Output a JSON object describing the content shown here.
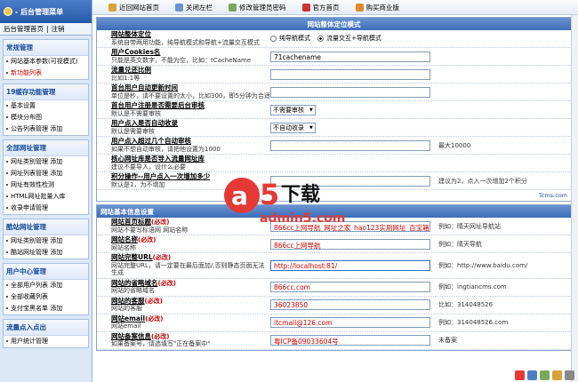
{
  "sidebar": {
    "title": "- 后台管理菜单",
    "user_links": [
      "后台管理首页",
      "注销"
    ],
    "groups": [
      {
        "title": "常规管理",
        "items": [
          {
            "label": "网站基本参数(可视模式)"
          },
          {
            "label": "新功能列表",
            "red": true
          }
        ]
      },
      {
        "title": "19缓存功能管理",
        "items": [
          {
            "label": "基本设置"
          },
          {
            "label": "模块分布图"
          },
          {
            "label": "公告列表管理  添加"
          }
        ]
      },
      {
        "title": "全部网址管理",
        "items": [
          {
            "label": "网址类别管理  添加"
          },
          {
            "label": "网址列表管理  添加"
          },
          {
            "label": "网址有效性检测"
          },
          {
            "label": "HTML网址批量入库"
          },
          {
            "label": "收录申请管理"
          }
        ]
      },
      {
        "title": "酷站网址管理",
        "items": [
          {
            "label": "网址类别管理  添加"
          },
          {
            "label": "酷站网址管理  添加"
          }
        ]
      },
      {
        "title": "用户中心管理",
        "items": [
          {
            "label": "全部用户列表  添加"
          },
          {
            "label": "全部收藏列表"
          },
          {
            "label": "支付宝黑名单  添加"
          }
        ]
      },
      {
        "title": "流量点入点出",
        "items": [
          {
            "label": "用户统计管理"
          }
        ]
      }
    ]
  },
  "topbar": {
    "links": [
      {
        "label": "近回网站首页",
        "icon": "home-icon",
        "color": "#d9a13a"
      },
      {
        "label": "关闭左栏",
        "icon": "close-sidebar-icon",
        "color": "#6b93d0"
      },
      {
        "label": "修改管理员密码",
        "icon": "key-icon",
        "color": "#7aa85a"
      },
      {
        "label": "官方首页",
        "icon": "flag-icon",
        "color": "#cc3333"
      },
      {
        "label": "购买商业版",
        "icon": "cart-icon",
        "color": "#e08a2a"
      }
    ]
  },
  "panel1": {
    "title": "网站整体定位模式",
    "rows": [
      {
        "label": "网站整体定位",
        "desc": "系统自带两用功能，纯导航模式和导航+流量交互模式",
        "type": "radio",
        "options": [
          "纯导航模式",
          "流量交互+导航模式"
        ],
        "selected": 1
      },
      {
        "label": "用户Cookies名",
        "desc": "只能是英文数字，不能为空，比如：tCacheName",
        "type": "input",
        "value": "71cachename",
        "black": true
      },
      {
        "label": "流量兑还比例",
        "desc": "比如1:1等",
        "type": "input",
        "value": "",
        "black": true
      },
      {
        "label": "首台用户自动更新时间",
        "desc": "单位是秒，请不要设置的太小，比如300，即5分钟为合适",
        "type": "input",
        "value": "",
        "black": true
      },
      {
        "label": "首台用户注册是否需要后台审核",
        "desc": "默认是不需要审核",
        "type": "select",
        "value": "不需要审核"
      },
      {
        "label": "用户点入是否自动收录",
        "desc": "默认是需要审核",
        "type": "select",
        "value": "不自动收录"
      },
      {
        "label": "用户点入超过几个自动审核",
        "desc": "如果不想自动审核，请把他设置为1000",
        "type": "input",
        "value": "",
        "black": true,
        "example": "最大10000"
      },
      {
        "label": "核心网址库是否导入流量网址库",
        "desc": "建议不要导入，设什么必要",
        "type": "none"
      },
      {
        "label": "积分操作--用户点入一次增加多少",
        "desc": "默认是1，为不增加",
        "type": "input",
        "value": "",
        "black": true,
        "example": "建议为2，点入一次增加2个积分"
      }
    ],
    "footer": "Tcms.com"
  },
  "panel2": {
    "title": "网站基本信息设置",
    "rows": [
      {
        "label": "网站首页标题",
        "req": "(必改)",
        "desc": "网站不要写标语网 网站名称",
        "value": "866cc上网导航_网址之家_hao123实用网址_百宝箱",
        "example": "例如：晴天网址导航站"
      },
      {
        "label": "网站名称",
        "req": "(必改)",
        "desc": "网站名称",
        "value": "866cc上网导航",
        "example": "例如：晴天导航"
      },
      {
        "label": "网站完整URL",
        "req": "(必改)",
        "desc": "网站完整URL，请一定要在最后面加/,否则静态页面无法生成",
        "value": "http://localhost:81/",
        "example": "例如：http://www.baidu.com/",
        "focused": true
      },
      {
        "label": "网站的省略域名",
        "req": "(必改)",
        "desc": "网站的省略域名",
        "value": "866cc.com",
        "example": "例如：ingtiancms.com"
      },
      {
        "label": "网站的客服",
        "req": "(必改)",
        "desc": "网站的客服",
        "value": "36023850",
        "example": "比如：314048526"
      },
      {
        "label": "网站email",
        "req": "(必改)",
        "desc": "网站email",
        "value": "itcmall@126.com",
        "example": "例如：314048526.com"
      },
      {
        "label": "网站备案信息",
        "req": "(必改)",
        "desc": "如果备案号，请选填写\"正在备案中\"",
        "value": "粤ICP备09033604号",
        "example": "未备案"
      }
    ]
  },
  "watermark": {
    "big": "下载",
    "url": "admin5.com"
  }
}
